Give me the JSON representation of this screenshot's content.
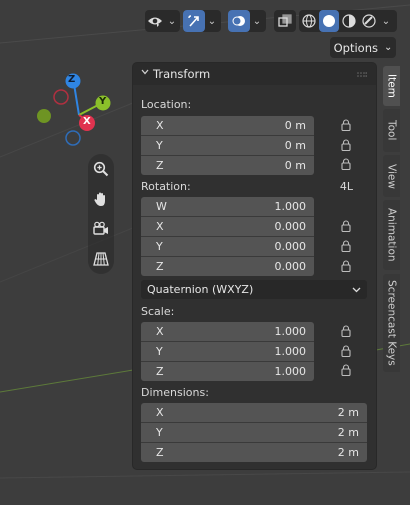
{
  "header": {
    "options_label": "Options",
    "buttons": [
      {
        "name": "visibility",
        "icon": "eye-pointer-icon"
      },
      {
        "name": "gizmo",
        "icon": "gizmo-arrow-icon",
        "active": true
      },
      {
        "name": "overlays",
        "icon": "overlays-icon",
        "active": true
      },
      {
        "name": "xray",
        "icon": "xray-icon"
      },
      {
        "name": "shading",
        "icons": [
          "wireframe-icon",
          "solid-icon",
          "material-icon",
          "rendered-icon"
        ]
      }
    ]
  },
  "gizmo": {
    "x": "X",
    "y": "Y",
    "z": "Z"
  },
  "nav_tools": [
    "zoom-icon",
    "hand-pan-icon",
    "camera-icon",
    "grid-perspective-icon"
  ],
  "panel": {
    "title": "Transform",
    "location": {
      "label": "Location:",
      "fields": [
        {
          "axis": "X",
          "value": "0 m"
        },
        {
          "axis": "Y",
          "value": "0 m"
        },
        {
          "axis": "Z",
          "value": "0 m"
        }
      ]
    },
    "rotation": {
      "label": "Rotation:",
      "extra": "4L",
      "fields": [
        {
          "axis": "W",
          "value": "1.000"
        },
        {
          "axis": "X",
          "value": "0.000"
        },
        {
          "axis": "Y",
          "value": "0.000"
        },
        {
          "axis": "Z",
          "value": "0.000"
        }
      ],
      "mode": "Quaternion (WXYZ)"
    },
    "scale": {
      "label": "Scale:",
      "fields": [
        {
          "axis": "X",
          "value": "1.000"
        },
        {
          "axis": "Y",
          "value": "1.000"
        },
        {
          "axis": "Z",
          "value": "1.000"
        }
      ]
    },
    "dimensions": {
      "label": "Dimensions:",
      "fields": [
        {
          "axis": "X",
          "value": "2 m"
        },
        {
          "axis": "Y",
          "value": "2 m"
        },
        {
          "axis": "Z",
          "value": "2 m"
        }
      ]
    }
  },
  "tabs": [
    {
      "label": "Item",
      "active": true
    },
    {
      "label": "Tool"
    },
    {
      "label": "View"
    },
    {
      "label": "Animation"
    },
    {
      "label": "Screencast Keys"
    }
  ],
  "colors": {
    "accent": "#4772b3",
    "axis_x": "#e0334f",
    "axis_y": "#8bc02a",
    "axis_z": "#2f85e3",
    "panel_bg": "#303030",
    "field_bg": "#545454"
  }
}
